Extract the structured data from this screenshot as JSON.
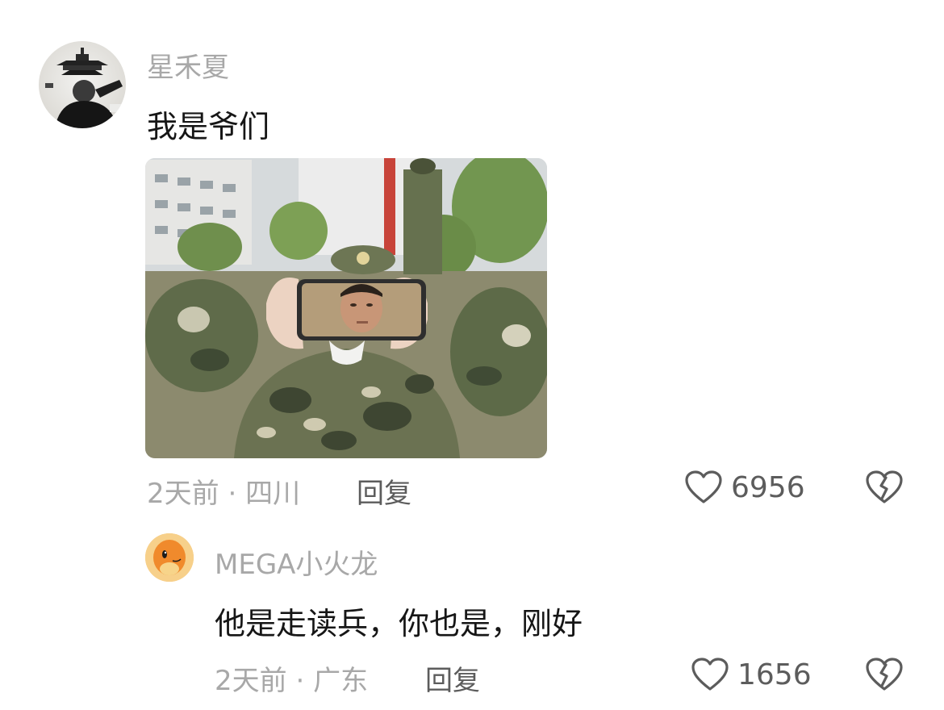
{
  "comments": [
    {
      "username": "星禾夏",
      "text": "我是爷们",
      "time": "2天前",
      "location": "四川",
      "separator": "·",
      "reply_label": "回复",
      "likes": "6956",
      "image": "photo of a soldier holding a phone showing a face",
      "avatar": "black-and-white-photo-avatar"
    },
    {
      "username": "MEGA小火龙",
      "text": "他是走读兵，你也是，刚好",
      "time": "2天前",
      "location": "广东",
      "separator": "·",
      "reply_label": "回复",
      "likes": "1656",
      "avatar": "charmander-avatar"
    }
  ],
  "icons": {
    "like": "heart-outline-icon",
    "dislike": "broken-heart-icon"
  },
  "colors": {
    "username": "#a8a8a8",
    "text": "#161616",
    "secondary": "#5c5c5c",
    "background": "#ffffff"
  }
}
